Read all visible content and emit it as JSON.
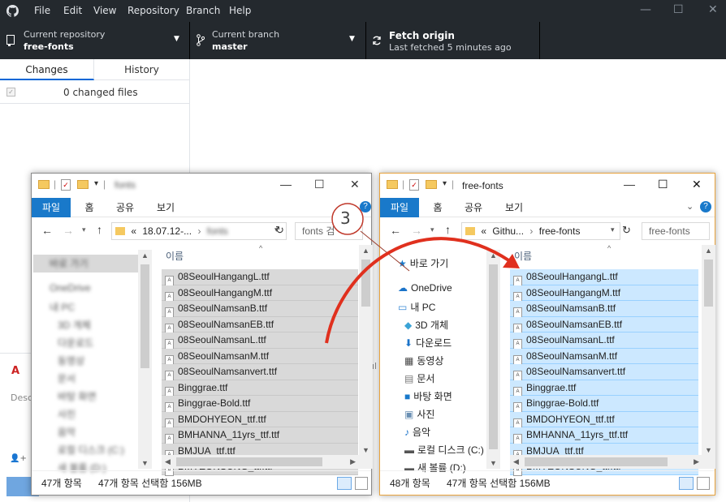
{
  "app": {
    "menus": [
      "File",
      "Edit",
      "View",
      "Repository",
      "Branch",
      "Help"
    ],
    "window_controls": [
      "—",
      "☐",
      "✕"
    ]
  },
  "toolbar": {
    "repo": {
      "label": "Current repository",
      "value": "free-fonts"
    },
    "branch": {
      "label": "Current branch",
      "value": "master"
    },
    "fetch": {
      "label": "Fetch origin",
      "sub": "Last fetched 5 minutes ago"
    }
  },
  "sidebar": {
    "tabs": [
      "Changes",
      "History"
    ],
    "changed_files": "0 changed files",
    "desc_placeholder": "Desc"
  },
  "explorer_left": {
    "ribbon_tabs": [
      "파일",
      "홈",
      "공유",
      "보기"
    ],
    "address": [
      "«",
      "18.07.12-...",
      "›",
      "fonts"
    ],
    "search_placeholder": "fonts 검",
    "column_header": "이름",
    "nav_items": [
      "바로 가기",
      "OneDrive",
      "내 PC",
      "3D 개체",
      "다운로드",
      "동영상",
      "문서",
      "바탕 화면",
      "사진",
      "음악",
      "로컬 디스크 (C:)",
      "새 볼륨 (D:)"
    ],
    "files": [
      "08SeoulHangangL.ttf",
      "08SeoulHangangM.ttf",
      "08SeoulNamsanB.ttf",
      "08SeoulNamsanEB.ttf",
      "08SeoulNamsanL.ttf",
      "08SeoulNamsanM.ttf",
      "08SeoulNamsanvert.ttf",
      "Binggrae.ttf",
      "Binggrae-Bold.ttf",
      "BMDOHYEON_ttf.ttf",
      "BMHANNA_11yrs_ttf.ttf",
      "BMJUA_ttf.ttf",
      "BMYEONSUNG_ttf.ttf"
    ],
    "status_count": "47개 항목",
    "status_selected": "47개 항목 선택함 156MB"
  },
  "explorer_right": {
    "title": "free-fonts",
    "ribbon_tabs": [
      "파일",
      "홈",
      "공유",
      "보기"
    ],
    "address": [
      "«",
      "Githu...",
      "›",
      "free-fonts"
    ],
    "search_placeholder": "free-fonts",
    "column_header": "이름",
    "nav_items": [
      "바로 가기",
      "OneDrive",
      "내 PC",
      "3D 개체",
      "다운로드",
      "동영상",
      "문서",
      "바탕 화면",
      "사진",
      "음악",
      "로컬 디스크 (C:)",
      "새 볼륨 (D:)"
    ],
    "files": [
      "08SeoulHangangL.ttf",
      "08SeoulHangangM.ttf",
      "08SeoulNamsanB.ttf",
      "08SeoulNamsanEB.ttf",
      "08SeoulNamsanL.ttf",
      "08SeoulNamsanM.ttf",
      "08SeoulNamsanvert.ttf",
      "Binggrae.ttf",
      "Binggrae-Bold.ttf",
      "BMDOHYEON_ttf.ttf",
      "BMHANNA_11yrs_ttf.ttf",
      "BMJUA_ttf.ttf",
      "BMYEONSUNG_ttf.ttf"
    ],
    "status_count": "48개 항목",
    "status_selected": "47개 항목 선택함 156MB"
  },
  "annotation": {
    "step": "3",
    "color": "#e0301e"
  },
  "colors": {
    "github_dark": "#24292e",
    "ribbon_blue": "#1979ca",
    "sel_gray": "#d9d9d9",
    "sel_blue": "#cce8ff",
    "frame_orange": "#e8a33d"
  }
}
